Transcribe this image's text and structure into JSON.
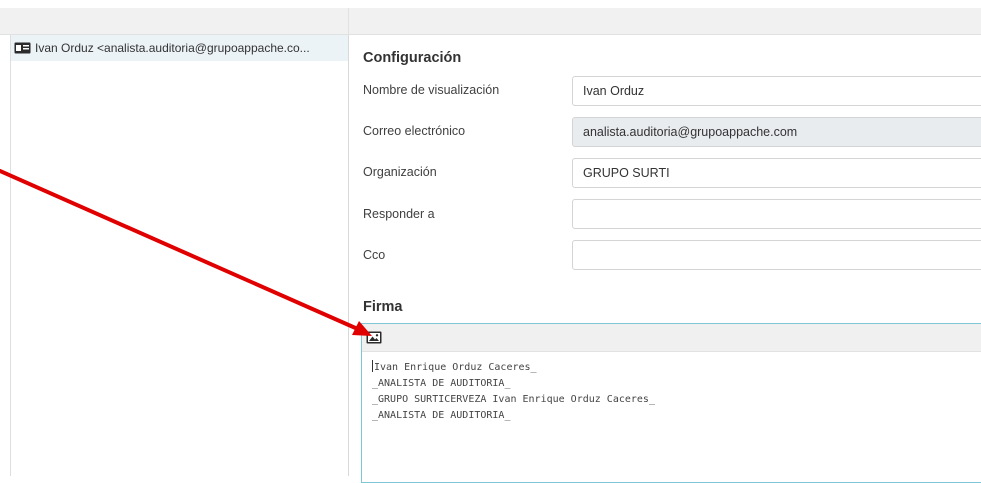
{
  "identities": {
    "items": [
      {
        "label": "Ivan Orduz <analista.auditoria@grupoappache.co...",
        "icon": "identity-card-icon"
      }
    ]
  },
  "settings": {
    "section_title": "Configuración",
    "fields": {
      "display_name": {
        "label": "Nombre de visualización",
        "value": "Ivan Orduz"
      },
      "email": {
        "label": "Correo electrónico",
        "value": "analista.auditoria@grupoappache.com"
      },
      "organization": {
        "label": "Organización",
        "value": "GRUPO SURTI"
      },
      "reply_to": {
        "label": "Responder a",
        "value": ""
      },
      "bcc": {
        "label": "Cco",
        "value": ""
      }
    }
  },
  "signature": {
    "section_title": "Firma",
    "toolbar_icon": "insert-image-icon",
    "lines": [
      "Ivan Enrique Orduz Caceres_",
      "_ANALISTA DE AUDITORIA_",
      "_GRUPO SURTICERVEZA Ivan Enrique Orduz Caceres_",
      "_ANALISTA DE AUDITORIA_"
    ]
  },
  "colors": {
    "selected_row": "#ecf3f7",
    "editor_border": "#7fc6d6",
    "annotation_arrow": "#e00000",
    "readonly_field": "#e9ecef"
  }
}
